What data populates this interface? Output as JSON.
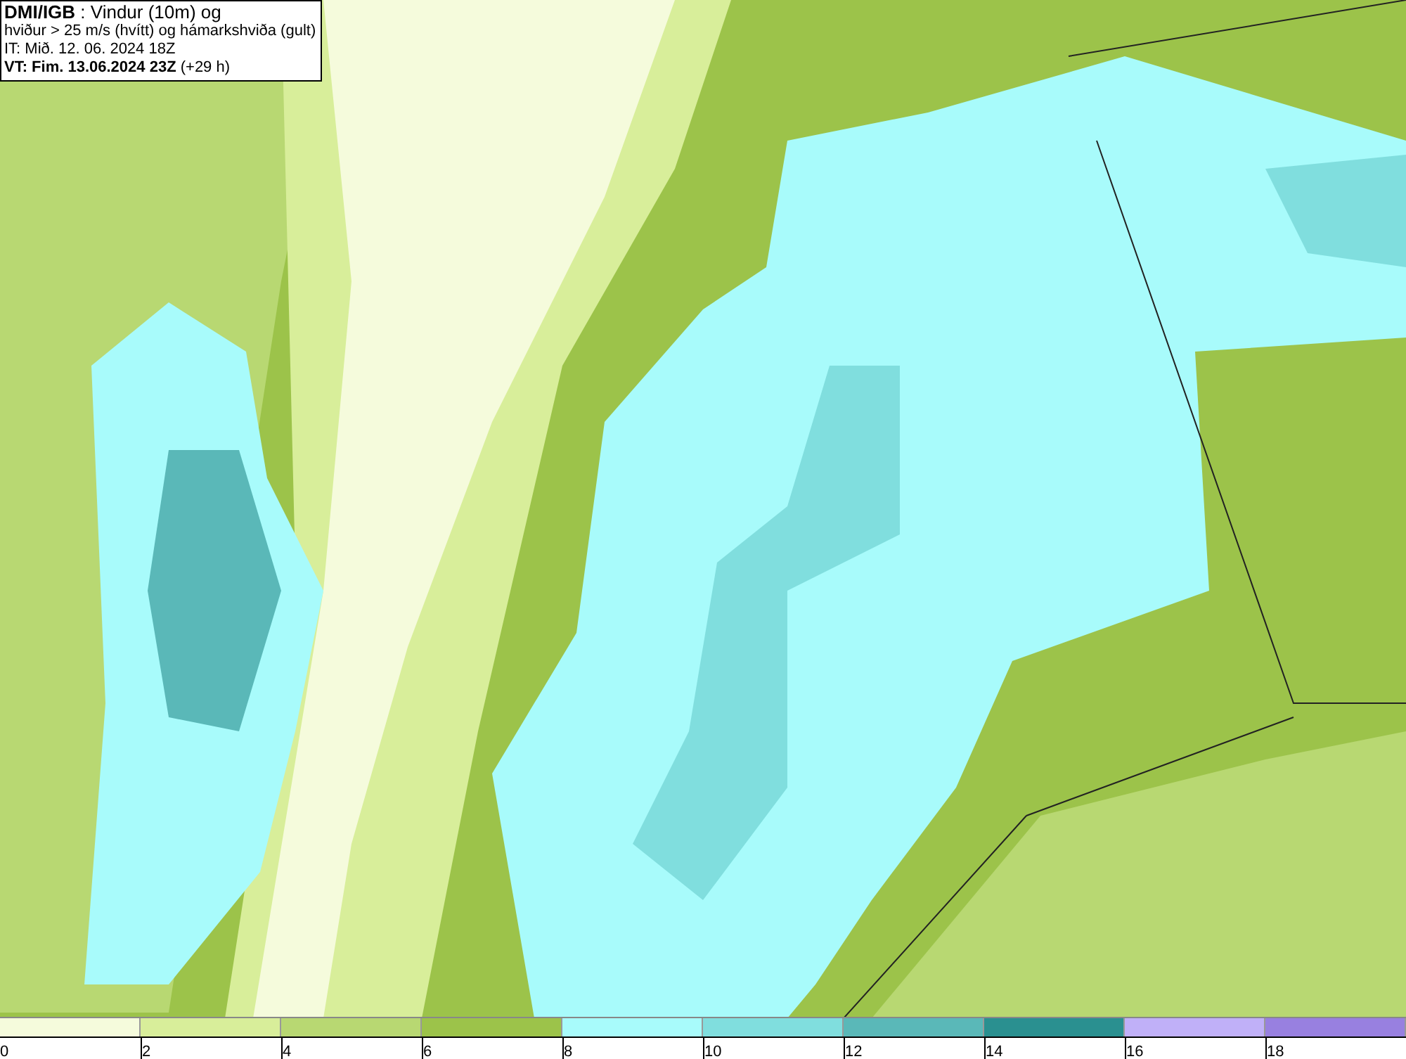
{
  "title_box": {
    "lines": [
      "**DMI/IGB** : Vindur (10m) og",
      "hviður > 25 m/s (hvítt) og hámarkshviða (gult)",
      "IT: Mið. 12. 06. 2024 18Z",
      "**VT: Fim. 13.06.2024 23Z** (+29 h)"
    ]
  },
  "legend": [
    {
      "label": "0",
      "color": "#f5fbdc"
    },
    {
      "label": "2",
      "color": "#d8ee9a"
    },
    {
      "label": "4",
      "color": "#b8d872"
    },
    {
      "label": "6",
      "color": "#9cc34a"
    },
    {
      "label": "8",
      "color": "#a8fbfb"
    },
    {
      "label": "10",
      "color": "#80dede"
    },
    {
      "label": "12",
      "color": "#5ab8b8"
    },
    {
      "label": "14",
      "color": "#2a9090"
    },
    {
      "label": "16",
      "color": "#c0b0f8"
    },
    {
      "label": "18",
      "color": "#9880e0"
    }
  ]
}
